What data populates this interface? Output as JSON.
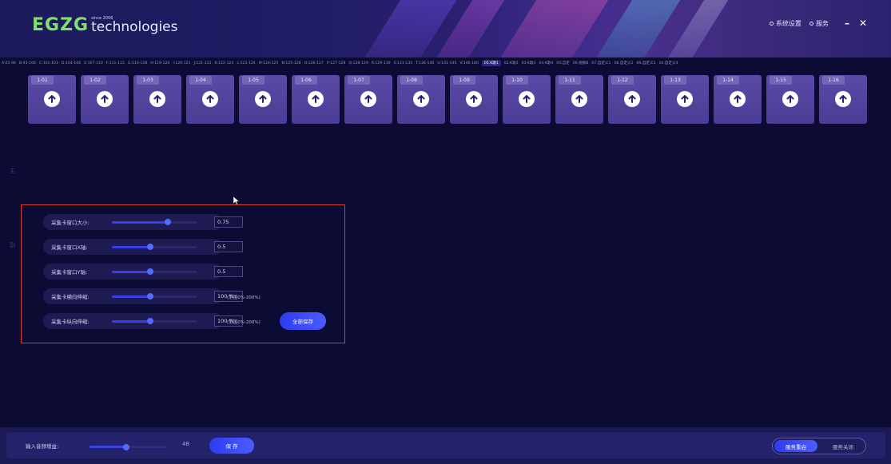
{
  "header": {
    "logo_mark": "EGZG",
    "logo_since": "since 2006",
    "logo_text": "technologies",
    "settings_label": "系统设置",
    "service_label": "服务",
    "minimize_symbol": "–",
    "close_symbol": "✕"
  },
  "scenes": [
    "A:01-90",
    "B:91-100",
    "C:101-103",
    "D:104-106",
    "E:107-110",
    "F:111-115",
    "G:116-118",
    "H:119-120",
    "I:120-121",
    "J:121-122",
    "K:122-123",
    "L:123-124",
    "M:124-125",
    "N:125-126",
    "O:126-127",
    "P:127-128",
    "Q:128-129",
    "R:129-130",
    "S:131-135",
    "T:136-140",
    "U:141-145",
    "V:146-180",
    "01.K歌1",
    "02.K歌2",
    "03.K歌3",
    "04.K歌4",
    "05.自定",
    "06.视频B",
    "07.自定义1",
    "08.自定义2",
    "09.自定义3",
    "10.自定义4"
  ],
  "active_scene": "01.K歌1",
  "channels": [
    "1-01",
    "1-02",
    "1-03",
    "1-04",
    "1-05",
    "1-06",
    "1-07",
    "1-08",
    "1-09",
    "1-10",
    "1-11",
    "1-12",
    "1-13",
    "1-14",
    "1-15",
    "1-16"
  ],
  "side_marks": [
    "主",
    "副"
  ],
  "capture": {
    "rows": [
      {
        "label": "采集卡窗口大小:",
        "value": "0.75",
        "level": 0.66,
        "hint": ""
      },
      {
        "label": "采集卡窗口X轴:",
        "value": "0.5",
        "level": 0.45,
        "hint": ""
      },
      {
        "label": "采集卡窗口Y轴:",
        "value": "0.5",
        "level": 0.45,
        "hint": ""
      },
      {
        "label": "采集卡横向伸缩:",
        "value": "100 %",
        "level": 0.45,
        "hint": "(范围0%-200%)"
      },
      {
        "label": "采集卡纵向伸缩:",
        "value": "100 %",
        "level": 0.45,
        "hint": "(范围0%-200%)"
      }
    ],
    "save_all_label": "全部保存"
  },
  "footer": {
    "gain_label": "输入音频增益:",
    "gain_value": "48",
    "gain_level": 0.48,
    "save_label": "保 存",
    "restart_label": "服务重启",
    "stop_label": "服务关闭"
  },
  "colors": {
    "accent": "#3b3ee6",
    "highlight_border": "#e0392f",
    "logo_green": "#7fe06a",
    "card": "#5b4aa6"
  }
}
